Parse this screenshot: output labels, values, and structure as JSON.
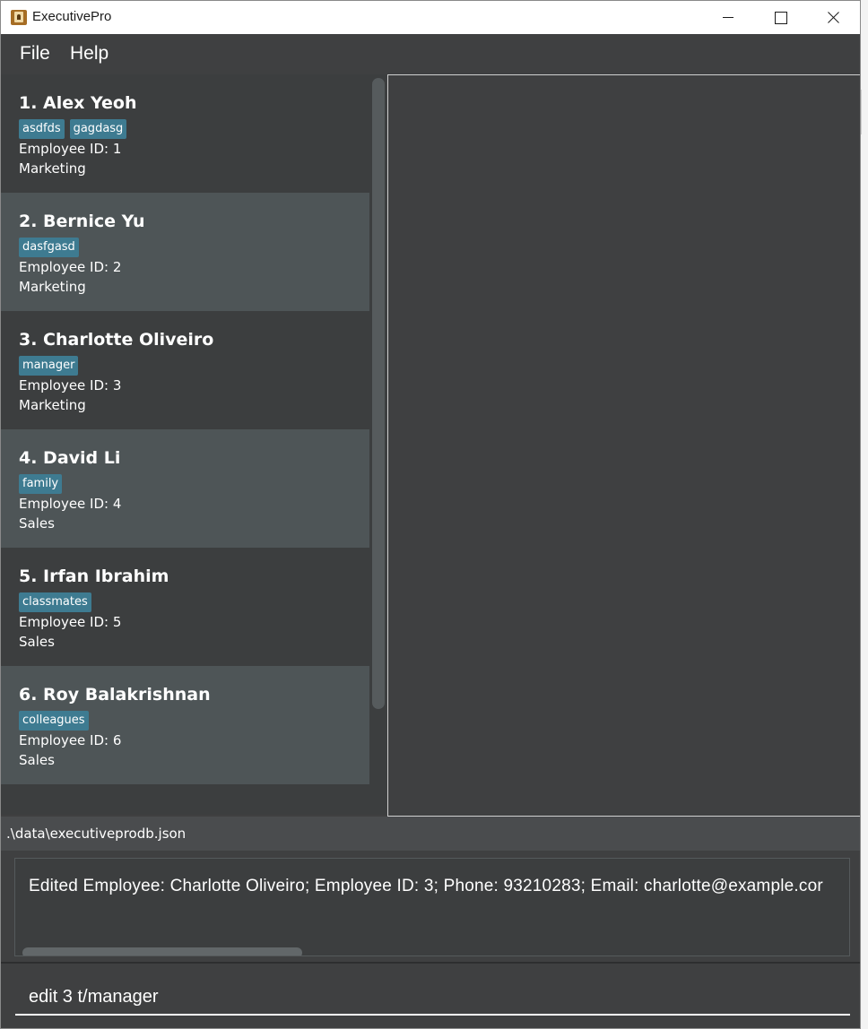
{
  "window": {
    "title": "ExecutivePro"
  },
  "menu": {
    "file": "File",
    "help": "Help"
  },
  "employees": [
    {
      "name": "1.  Alex Yeoh",
      "tags": [
        "asdfds",
        "gagdasg"
      ],
      "id_text": "Employee ID: 1",
      "department": "Marketing"
    },
    {
      "name": "2.  Bernice Yu",
      "tags": [
        "dasfgasd"
      ],
      "id_text": "Employee ID: 2",
      "department": "Marketing"
    },
    {
      "name": "3.  Charlotte Oliveiro",
      "tags": [
        "manager"
      ],
      "id_text": "Employee ID: 3",
      "department": "Marketing"
    },
    {
      "name": "4.  David Li",
      "tags": [
        "family"
      ],
      "id_text": "Employee ID: 4",
      "department": "Sales"
    },
    {
      "name": "5.  Irfan Ibrahim",
      "tags": [
        "classmates"
      ],
      "id_text": "Employee ID: 5",
      "department": "Sales"
    },
    {
      "name": "6.  Roy Balakrishnan",
      "tags": [
        "colleagues"
      ],
      "id_text": "Employee ID: 6",
      "department": "Sales"
    }
  ],
  "status": {
    "file_path": ".\\data\\executiveprodb.json"
  },
  "result": {
    "message": "Edited Employee: Charlotte Oliveiro; Employee ID: 3; Phone: 93210283; Email: charlotte@example.cor"
  },
  "command": {
    "value": "edit 3 t/manager"
  },
  "colors": {
    "background": "#3f4041",
    "card_alt": "#4e5557",
    "tag": "#3e7b91"
  }
}
